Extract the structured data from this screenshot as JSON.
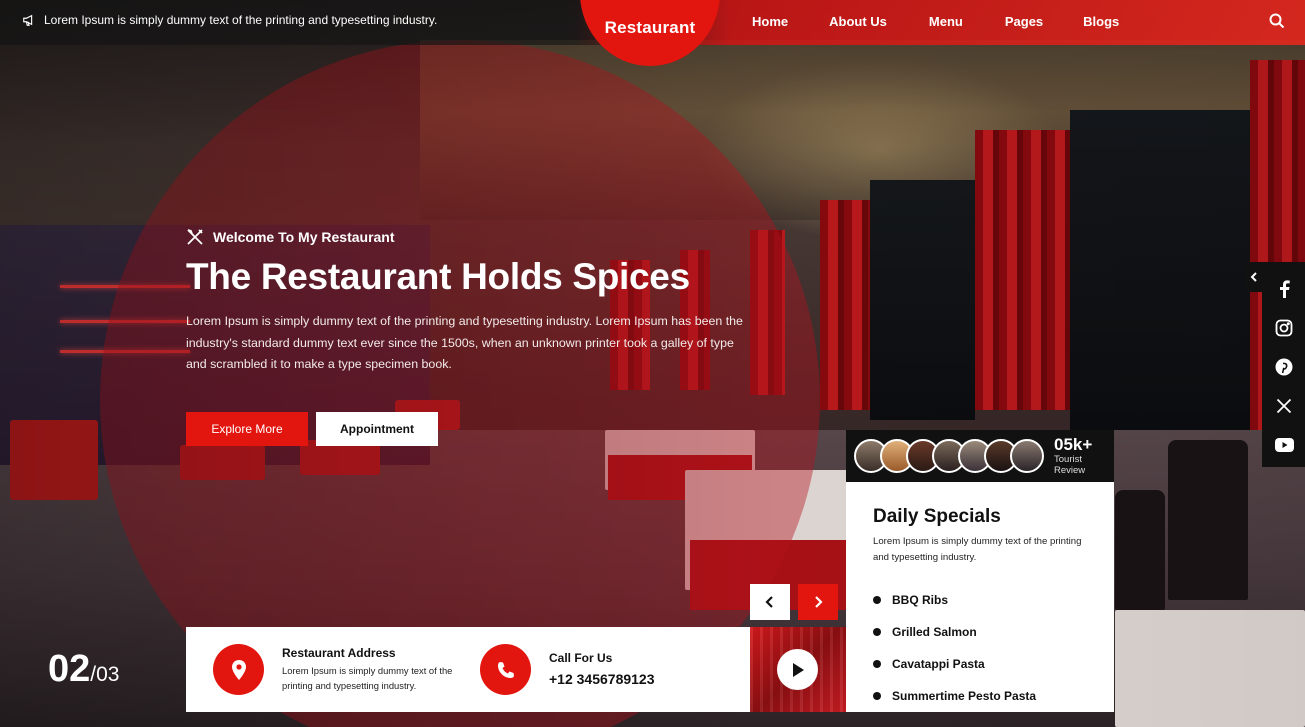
{
  "topbar": {
    "announcement": "Lorem Ipsum is simply dummy text of the printing and typesetting industry.",
    "brand": "Restaurant",
    "nav": [
      "Home",
      "About Us",
      "Menu",
      "Pages",
      "Blogs"
    ]
  },
  "hero": {
    "eyebrow": "Welcome To My Restaurant",
    "title": "The Restaurant Holds Spices",
    "text": "Lorem Ipsum is simply dummy text of the printing and typesetting industry. Lorem Ipsum has been the industry's standard dummy text ever since the 1500s, when an unknown printer took a galley of type and scrambled it to make a type specimen book.",
    "primary_button": "Explore More",
    "secondary_button": "Appointment"
  },
  "slide": {
    "current": "02",
    "total": "/03"
  },
  "reviews": {
    "count": "05k+",
    "label": "Tourist Review"
  },
  "specials": {
    "title": "Daily Specials",
    "description": "Lorem Ipsum is simply dummy text of the printing and typesetting industry.",
    "items": [
      "BBQ Ribs",
      "Grilled Salmon",
      "Cavatappi Pasta",
      "Summertime Pesto Pasta"
    ]
  },
  "info": {
    "address_title": "Restaurant Address",
    "address_text": "Lorem Ipsum is simply dummy text of the printing and typesetting industry.",
    "call_title": "Call For Us",
    "phone": "+12 3456789123"
  },
  "social": [
    "facebook-icon",
    "instagram-icon",
    "pinterest-icon",
    "x-icon",
    "youtube-icon"
  ],
  "colors": {
    "accent": "#e3150f",
    "dark": "#111111"
  }
}
